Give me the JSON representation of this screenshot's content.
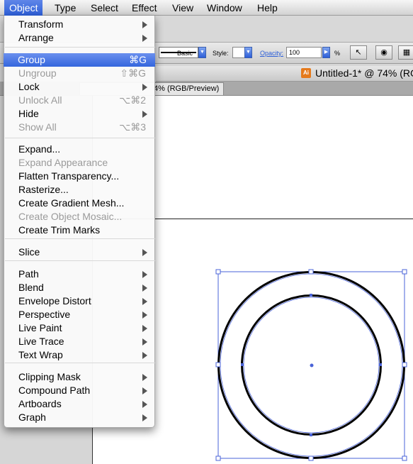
{
  "menubar": {
    "items": [
      "Object",
      "Type",
      "Select",
      "Effect",
      "View",
      "Window",
      "Help"
    ]
  },
  "control_panel": {
    "stroke_style": "Basic",
    "style_label": "Style:",
    "opacity_label": "Opacity:",
    "opacity_value": "100",
    "percent": "%"
  },
  "document": {
    "window_title": "Untitled-1* @ 74% (RG",
    "tab_label": "4% (RGB/Preview)",
    "app_icon_text": "Ai"
  },
  "menu": {
    "items": [
      {
        "label": "Transform",
        "shortcut": "",
        "submenu": true,
        "enabled": true
      },
      {
        "label": "Arrange",
        "shortcut": "",
        "submenu": true,
        "enabled": true
      },
      {
        "label": "Group",
        "shortcut": "⌘G",
        "submenu": false,
        "enabled": true,
        "highlighted": true
      },
      {
        "label": "Ungroup",
        "shortcut": "⇧⌘G",
        "submenu": false,
        "enabled": false
      },
      {
        "label": "Lock",
        "shortcut": "",
        "submenu": true,
        "enabled": true
      },
      {
        "label": "Unlock All",
        "shortcut": "⌥⌘2",
        "submenu": false,
        "enabled": false
      },
      {
        "label": "Hide",
        "shortcut": "",
        "submenu": true,
        "enabled": true
      },
      {
        "label": "Show All",
        "shortcut": "⌥⌘3",
        "submenu": false,
        "enabled": false
      },
      {
        "label": "Expand...",
        "shortcut": "",
        "submenu": false,
        "enabled": true
      },
      {
        "label": "Expand Appearance",
        "shortcut": "",
        "submenu": false,
        "enabled": false
      },
      {
        "label": "Flatten Transparency...",
        "shortcut": "",
        "submenu": false,
        "enabled": true
      },
      {
        "label": "Rasterize...",
        "shortcut": "",
        "submenu": false,
        "enabled": true
      },
      {
        "label": "Create Gradient Mesh...",
        "shortcut": "",
        "submenu": false,
        "enabled": true
      },
      {
        "label": "Create Object Mosaic...",
        "shortcut": "",
        "submenu": false,
        "enabled": false
      },
      {
        "label": "Create Trim Marks",
        "shortcut": "",
        "submenu": false,
        "enabled": true
      },
      {
        "label": "Slice",
        "shortcut": "",
        "submenu": true,
        "enabled": true
      },
      {
        "label": "Path",
        "shortcut": "",
        "submenu": true,
        "enabled": true
      },
      {
        "label": "Blend",
        "shortcut": "",
        "submenu": true,
        "enabled": true
      },
      {
        "label": "Envelope Distort",
        "shortcut": "",
        "submenu": true,
        "enabled": true
      },
      {
        "label": "Perspective",
        "shortcut": "",
        "submenu": true,
        "enabled": true
      },
      {
        "label": "Live Paint",
        "shortcut": "",
        "submenu": true,
        "enabled": true
      },
      {
        "label": "Live Trace",
        "shortcut": "",
        "submenu": true,
        "enabled": true
      },
      {
        "label": "Text Wrap",
        "shortcut": "",
        "submenu": true,
        "enabled": true
      },
      {
        "label": "Clipping Mask",
        "shortcut": "",
        "submenu": true,
        "enabled": true
      },
      {
        "label": "Compound Path",
        "shortcut": "",
        "submenu": true,
        "enabled": true
      },
      {
        "label": "Artboards",
        "shortcut": "",
        "submenu": true,
        "enabled": true
      },
      {
        "label": "Graph",
        "shortcut": "",
        "submenu": true,
        "enabled": true
      }
    ]
  },
  "colors": {
    "highlight": "#3466dd",
    "selection": "#4a63d8"
  },
  "icons": {
    "submenu": "chevron-right-icon",
    "document": "illustrator-doc-icon",
    "selection_tool": "arrow-tool-icon",
    "recolor": "recolor-icon",
    "align": "align-icon"
  }
}
